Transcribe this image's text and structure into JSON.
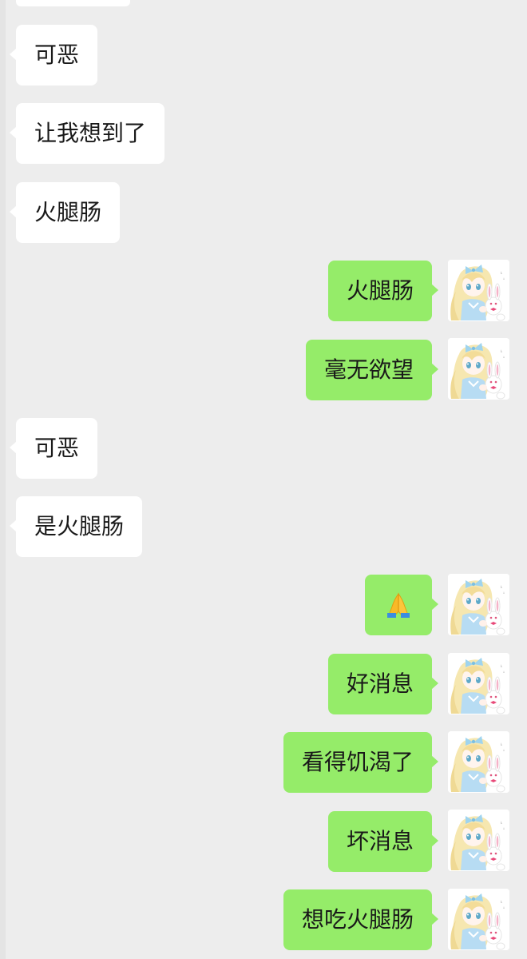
{
  "messages": [
    {
      "dir": "in",
      "text": "可恶"
    },
    {
      "dir": "in",
      "text": "让我想到了"
    },
    {
      "dir": "in",
      "text": "火腿肠"
    },
    {
      "dir": "out",
      "text": "火腿肠"
    },
    {
      "dir": "out",
      "text": "毫无欲望"
    },
    {
      "dir": "in",
      "text": "可恶"
    },
    {
      "dir": "in",
      "text": "是火腿肠"
    },
    {
      "dir": "out",
      "text": "",
      "emoji": "folded-hands-icon"
    },
    {
      "dir": "out",
      "text": "好消息"
    },
    {
      "dir": "out",
      "text": "看得饥渴了"
    },
    {
      "dir": "out",
      "text": "坏消息"
    },
    {
      "dir": "out",
      "text": "想吃火腿肠"
    }
  ],
  "colors": {
    "background": "#ededed",
    "incoming_bubble": "#ffffff",
    "outgoing_bubble": "#95ec69",
    "text": "#191919"
  },
  "avatar": {
    "icon": "anime-girl-bunny-avatar-icon"
  }
}
